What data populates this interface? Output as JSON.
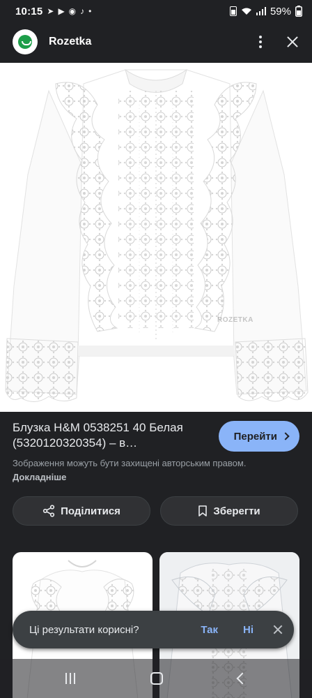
{
  "status_bar": {
    "time": "10:15",
    "notification_icons": [
      "telegram-icon",
      "send-icon",
      "chrome-icon",
      "tiktok-icon",
      "dot-icon"
    ],
    "battery": "59%"
  },
  "header": {
    "site_name": "Rozetka"
  },
  "image": {
    "watermark": "ROZETKA",
    "subject": "white-eyelet-blouse"
  },
  "result": {
    "title": "Блузка H&M 0538251 40 Белая (5320120320354) – в…",
    "visit_label": "Перейти",
    "copyright_text": "Зображення можуть бути захищені авторським правом.",
    "copyright_link": "Докладніше"
  },
  "actions": {
    "share_label": "Поділитися",
    "save_label": "Зберегти"
  },
  "feedback": {
    "question": "Ці результати корисні?",
    "yes": "Так",
    "no": "Ні"
  },
  "colors": {
    "background": "#202124",
    "accent": "#8ab4f8",
    "button_bg": "#303134",
    "toast_bg": "#3c4043",
    "logo_green": "#1d9e49"
  }
}
